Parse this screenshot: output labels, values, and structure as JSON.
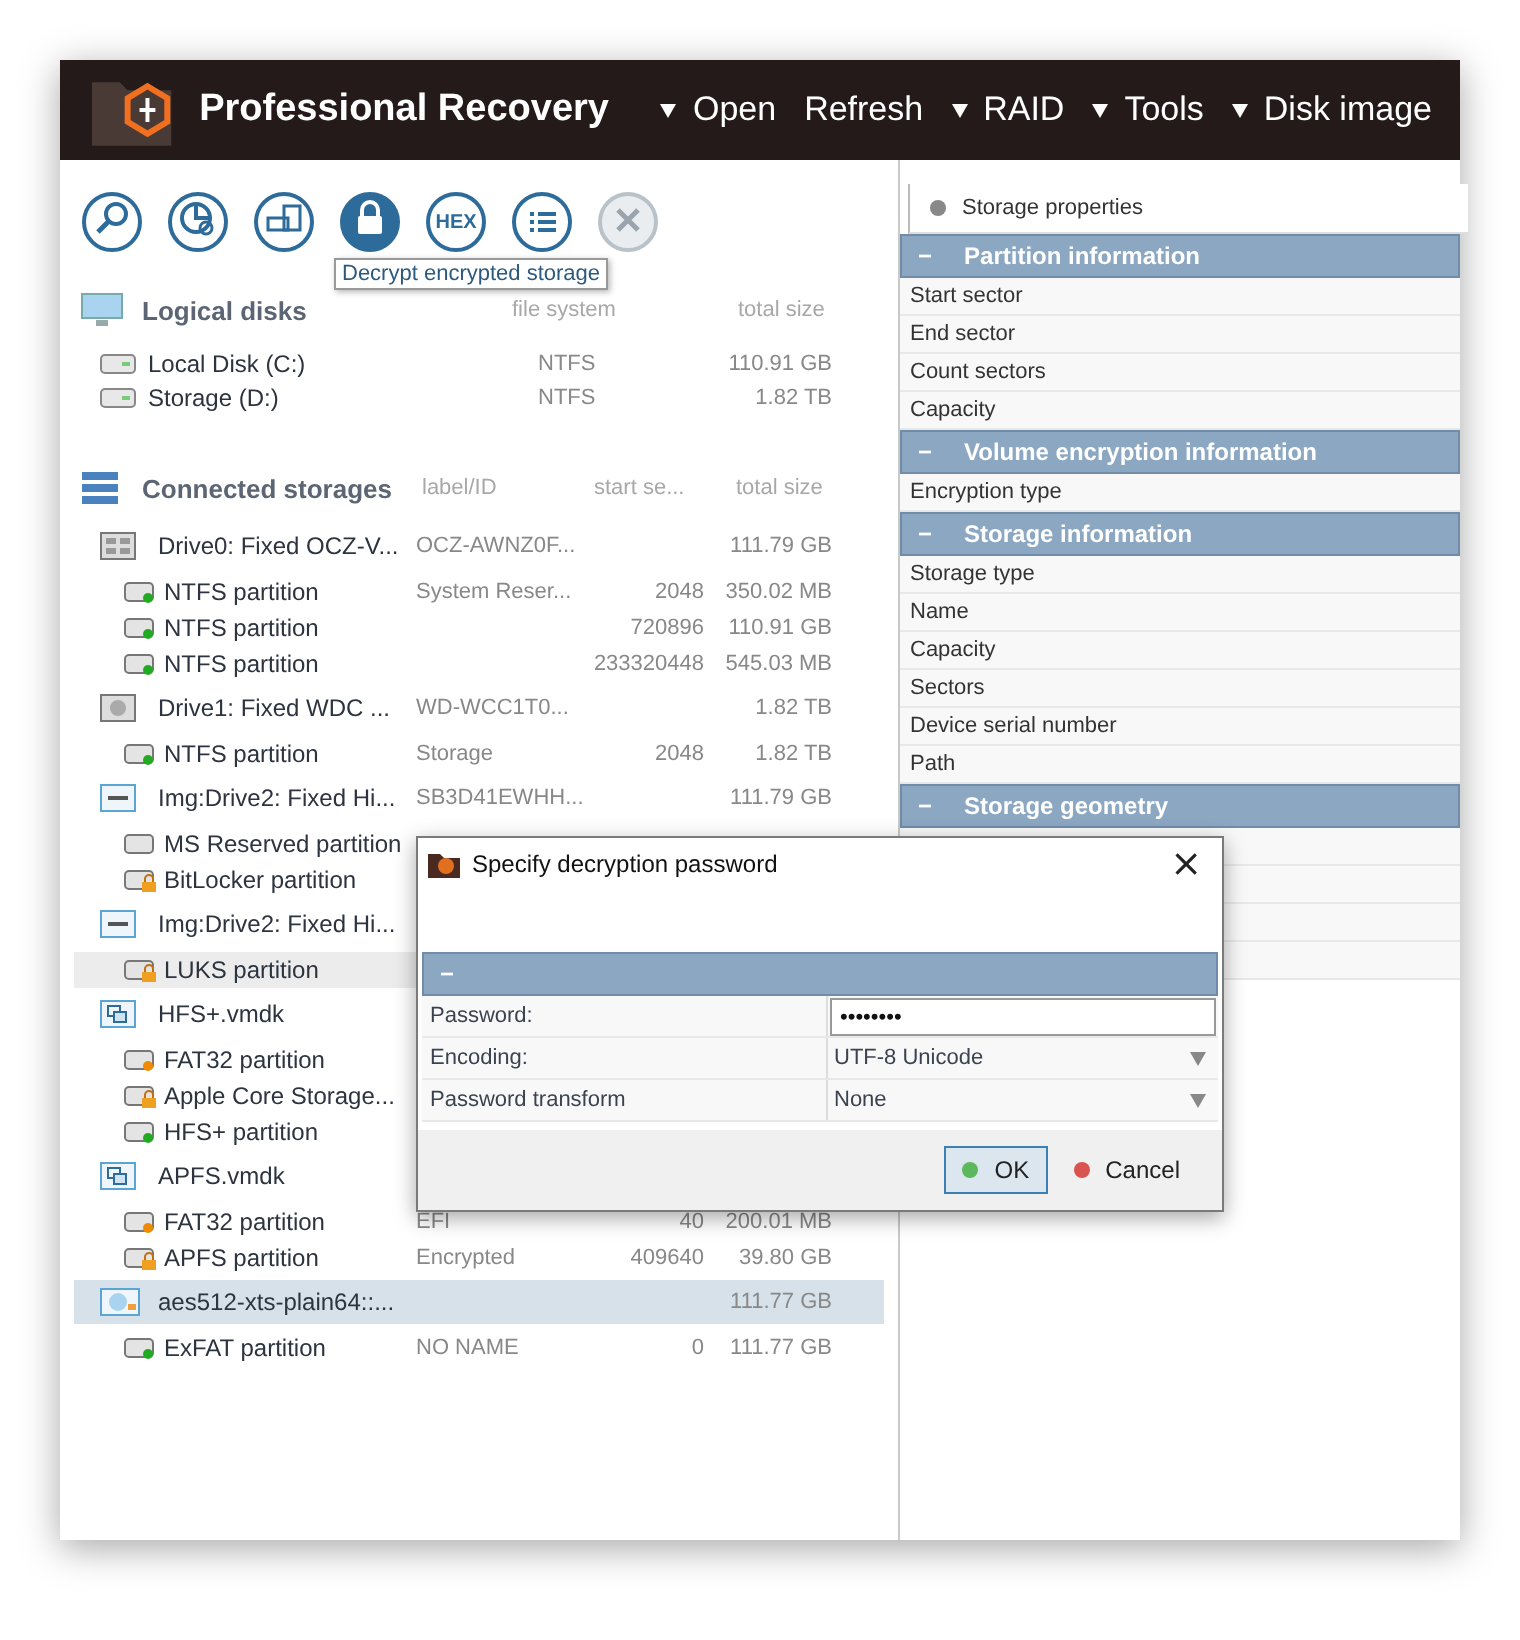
{
  "app": {
    "title": "Professional Recovery"
  },
  "menu": [
    {
      "label": "Open",
      "dropdown": true
    },
    {
      "label": "Refresh",
      "dropdown": false
    },
    {
      "label": "RAID",
      "dropdown": true
    },
    {
      "label": "Tools",
      "dropdown": true
    },
    {
      "label": "Disk image",
      "dropdown": true
    }
  ],
  "toolbar": {
    "buttons": [
      {
        "kind": "scan",
        "selected": false,
        "disabled": false
      },
      {
        "kind": "chart",
        "selected": false,
        "disabled": false
      },
      {
        "kind": "drives",
        "selected": false,
        "disabled": false
      },
      {
        "kind": "lock",
        "selected": true,
        "disabled": false
      },
      {
        "kind": "hex",
        "label": "HEX",
        "selected": false,
        "disabled": false
      },
      {
        "kind": "list",
        "selected": false,
        "disabled": false
      },
      {
        "kind": "close",
        "selected": false,
        "disabled": true
      }
    ],
    "tooltip": "Decrypt encrypted storage"
  },
  "logical_disks": {
    "title": "Logical disks",
    "columns": [
      "file system",
      "total size"
    ],
    "items": [
      {
        "name": "Local Disk (C:)",
        "file_system": "NTFS",
        "size": "110.91 GB"
      },
      {
        "name": "Storage (D:)",
        "file_system": "NTFS",
        "size": "1.82 TB"
      }
    ]
  },
  "connected_storages": {
    "title": "Connected storages",
    "columns": [
      "label/ID",
      "start se...",
      "total size"
    ],
    "items": [
      {
        "kind": "hdd-grid",
        "name": "Drive0: Fixed OCZ-V...",
        "label": "OCZ-AWNZ0F...",
        "size": "111.79 GB",
        "selected": false,
        "hovered": false,
        "children": [
          {
            "kind": "ok",
            "name": "NTFS partition",
            "label": "System Reser...",
            "start": "2048",
            "size": "350.02 MB",
            "selected": false,
            "hovered": false
          },
          {
            "kind": "ok",
            "name": "NTFS partition",
            "start": "720896",
            "size": "110.91 GB",
            "selected": false,
            "hovered": false
          },
          {
            "kind": "ok",
            "name": "NTFS partition",
            "start": "233320448",
            "size": "545.03 MB",
            "selected": false,
            "hovered": false
          }
        ]
      },
      {
        "kind": "hdd",
        "name": "Drive1: Fixed WDC ...",
        "label": "WD-WCC1T0...",
        "size": "1.82 TB",
        "selected": false,
        "hovered": false,
        "children": [
          {
            "kind": "ok",
            "name": "NTFS partition",
            "label": "Storage",
            "start": "2048",
            "size": "1.82 TB",
            "selected": false,
            "hovered": false
          }
        ]
      },
      {
        "kind": "image",
        "name": "Img:Drive2: Fixed Hi...",
        "label": "SB3D41EWHH...",
        "size": "111.79 GB",
        "selected": false,
        "hovered": false,
        "children": [
          {
            "kind": "plain",
            "name": "MS Reserved partition",
            "selected": false,
            "hovered": false
          },
          {
            "kind": "locked",
            "name": "BitLocker partition",
            "selected": false,
            "hovered": false
          }
        ]
      },
      {
        "kind": "image",
        "name": "Img:Drive2: Fixed Hi...",
        "selected": false,
        "hovered": false,
        "children": [
          {
            "kind": "locked",
            "name": "LUKS partition",
            "selected": false,
            "hovered": true
          }
        ]
      },
      {
        "kind": "vmdk",
        "name": "HFS+.vmdk",
        "selected": false,
        "hovered": false,
        "children": [
          {
            "kind": "warn",
            "name": "FAT32 partition",
            "selected": false,
            "hovered": false
          },
          {
            "kind": "locked",
            "name": "Apple Core Storage...",
            "selected": false,
            "hovered": false
          },
          {
            "kind": "ok",
            "name": "HFS+ partition",
            "selected": false,
            "hovered": false
          }
        ]
      },
      {
        "kind": "vmdk",
        "name": "APFS.vmdk",
        "selected": false,
        "hovered": false,
        "children": [
          {
            "kind": "warn",
            "name": "FAT32 partition",
            "label": "EFI",
            "start": "40",
            "size": "200.01 MB",
            "selected": false,
            "hovered": false
          },
          {
            "kind": "locked",
            "name": "APFS partition",
            "label": "Encrypted",
            "start": "409640",
            "size": "39.80 GB",
            "selected": false,
            "hovered": false
          }
        ]
      },
      {
        "kind": "crypto",
        "name": "aes512-xts-plain64::...",
        "size": "111.77 GB",
        "selected": true,
        "hovered": false,
        "children": [
          {
            "kind": "ok",
            "name": "ExFAT partition",
            "label": "NO NAME",
            "start": "0",
            "size": "111.77 GB",
            "selected": false,
            "hovered": false
          }
        ]
      }
    ]
  },
  "properties": {
    "tab": "Storage properties",
    "sections": [
      {
        "toggle": "−",
        "title": "Partition information",
        "rows": [
          "Start sector",
          "End sector",
          "Count sectors",
          "Capacity"
        ]
      },
      {
        "toggle": "−",
        "title": "Volume encryption information",
        "rows": [
          "Encryption type"
        ]
      },
      {
        "toggle": "−",
        "title": "Storage information",
        "rows": [
          "Storage type",
          "Name",
          "Capacity",
          "Sectors",
          "Device serial number",
          "Path"
        ]
      },
      {
        "toggle": "−",
        "title": "Storage geometry"
      }
    ]
  },
  "dialog": {
    "title": "Specify decryption password",
    "close": "×",
    "group_toggle": "−",
    "fields": [
      {
        "kind": "password",
        "label": "Password:",
        "value": "••••••••"
      },
      {
        "kind": "select",
        "label": "Encoding:",
        "value": "UTF-8 Unicode"
      },
      {
        "kind": "select",
        "label": "Password transform",
        "value": "None"
      }
    ],
    "buttons": [
      {
        "label": "OK",
        "color": "#5cb85c",
        "default": true
      },
      {
        "label": "Cancel",
        "color": "#d9534f",
        "default": false
      }
    ]
  }
}
